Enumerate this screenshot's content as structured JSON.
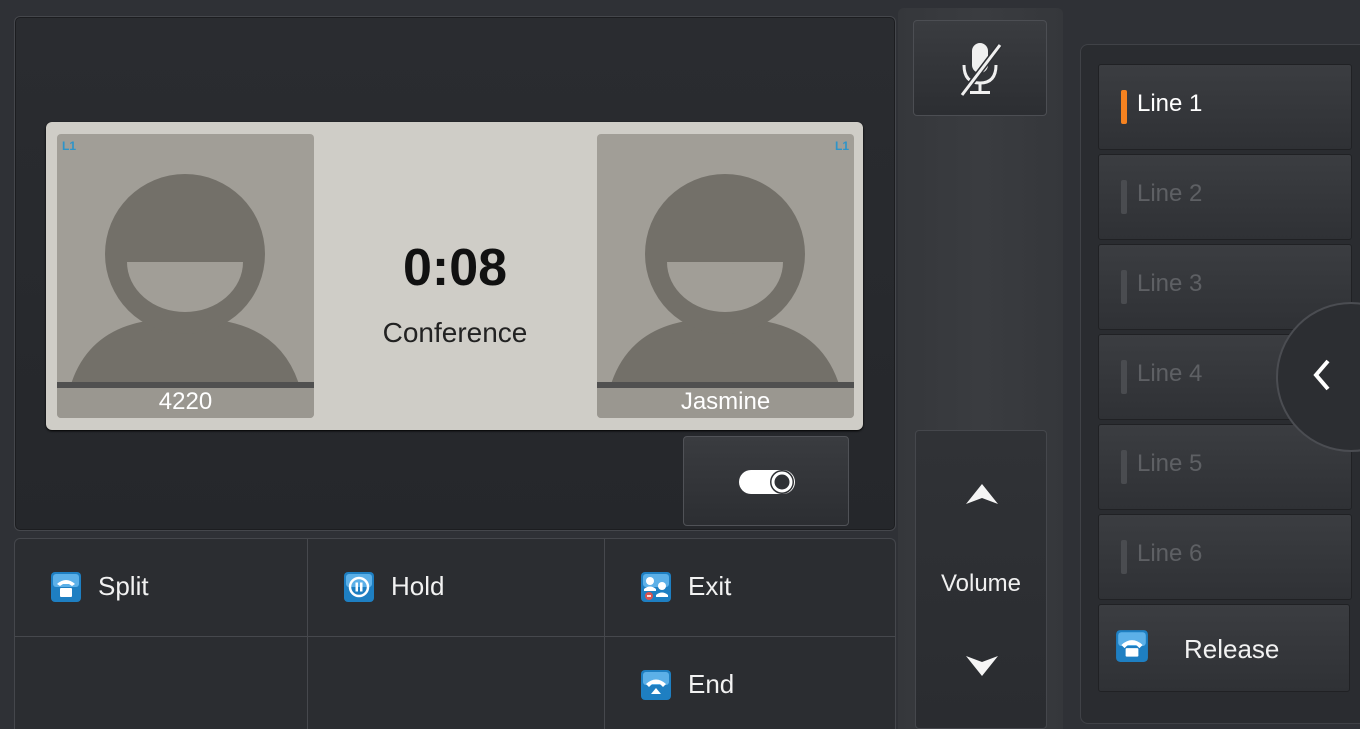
{
  "call": {
    "timer": "0:08",
    "type": "Conference",
    "participants": [
      {
        "name": "4220",
        "line_tag": "L1"
      },
      {
        "name": "Jasmine",
        "line_tag": "L1"
      }
    ]
  },
  "softkeys": {
    "split": "Split",
    "hold": "Hold",
    "exit": "Exit",
    "end": "End"
  },
  "volume": {
    "label": "Volume"
  },
  "lines": [
    {
      "label": "Line 1",
      "active": true
    },
    {
      "label": "Line 2",
      "active": false
    },
    {
      "label": "Line 3",
      "active": false
    },
    {
      "label": "Line 4",
      "active": false
    },
    {
      "label": "Line 5",
      "active": false
    },
    {
      "label": "Line 6",
      "active": false
    }
  ],
  "release": {
    "label": "Release"
  },
  "icons": {
    "mute": "microphone-mute-icon",
    "record": "record-toggle-icon",
    "volume_up": "arrow-up-icon",
    "volume_down": "arrow-down-icon",
    "collapse": "chevron-left-icon"
  },
  "colors": {
    "active_line_led": "#f58220",
    "line_tag": "#2e94c9",
    "softkey_icon": "#1e7fc2"
  }
}
